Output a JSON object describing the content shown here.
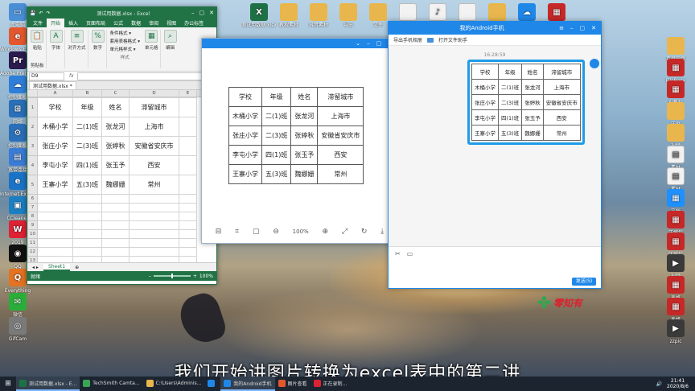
{
  "desktop": {
    "icons_left": [
      {
        "label": "此电脑",
        "color": "#4a8fd6",
        "glyph": "▭"
      },
      {
        "label": "Windows Explorer",
        "color": "#e4572e",
        "glyph": "e"
      },
      {
        "label": "Adobe Premiere Pro",
        "color": "#2b1a4d",
        "glyph": "Pr"
      },
      {
        "label": "控制面板",
        "color": "#2f7ed8",
        "glyph": "☁"
      },
      {
        "label": "网络",
        "color": "#2a6fb8",
        "glyph": "⊞"
      },
      {
        "label": "控制面板",
        "color": "#2a6fb8",
        "glyph": "⚙"
      },
      {
        "label": "宽带连接",
        "color": "#3a7bd5",
        "glyph": "▤"
      },
      {
        "label": "Internet Explorer",
        "color": "#1a73c7",
        "glyph": "e"
      },
      {
        "label": "CCleaner",
        "color": "#1c7fc4",
        "glyph": "▣"
      },
      {
        "label": "2019",
        "color": "#d23",
        "glyph": "W"
      },
      {
        "label": "QQ",
        "color": "#111",
        "glyph": "◉"
      },
      {
        "label": "Everything",
        "color": "#e37222",
        "glyph": "Q"
      },
      {
        "label": "微信",
        "color": "#2bad3a",
        "glyph": "✉"
      },
      {
        "label": "GifCam",
        "color": "#7a7a7a",
        "glyph": "◎"
      }
    ],
    "icons_top": [
      {
        "label": "测试用数据.xlsx",
        "color": "#1e7145",
        "glyph": "X"
      },
      {
        "label": "教程素材",
        "color": "#e8b64c",
        "glyph": ""
      },
      {
        "label": "抖音素材",
        "color": "#e8b64c",
        "glyph": ""
      },
      {
        "label": "导出",
        "color": "#e8b64c",
        "glyph": ""
      },
      {
        "label": "文件",
        "color": "#e8b64c",
        "glyph": ""
      },
      {
        "label": "新建",
        "color": "#f2f2f2",
        "glyph": ""
      },
      {
        "label": "WAV",
        "color": "#f2f2f2",
        "glyph": "♪"
      },
      {
        "label": "文件",
        "color": "#f2f2f2",
        "glyph": ""
      },
      {
        "label": "文件",
        "color": "#e8b64c",
        "glyph": ""
      },
      {
        "label": "上传",
        "color": "#1f87e8",
        "glyph": "☁"
      },
      {
        "label": "活动1",
        "color": "#c62828",
        "glyph": "▦"
      }
    ],
    "icons_right": [
      {
        "label": "百度网盘",
        "color": "#e8b64c",
        "glyph": ""
      },
      {
        "label": "FileRecv",
        "color": "#c62828",
        "glyph": "▦"
      },
      {
        "label": "AI教程",
        "color": "#c62828",
        "glyph": "▦"
      },
      {
        "label": "压缩",
        "color": "#e8b64c",
        "glyph": ""
      },
      {
        "label": "视频",
        "color": "#e8b64c",
        "glyph": ""
      },
      {
        "label": "素材",
        "color": "#f2f2f2",
        "glyph": "▤"
      },
      {
        "label": "素材",
        "color": "#f2f2f2",
        "glyph": "▤"
      },
      {
        "label": "文档",
        "color": "#1e90ff",
        "glyph": "▦"
      },
      {
        "label": "压缩包",
        "color": "#c62828",
        "glyph": "▦"
      },
      {
        "label": "压缩包",
        "color": "#c62828",
        "glyph": "▦"
      },
      {
        "label": "视频",
        "color": "#3a3a3a",
        "glyph": "▶"
      },
      {
        "label": "表格",
        "color": "#c62828",
        "glyph": "▦"
      },
      {
        "label": "表格",
        "color": "#c62828",
        "glyph": "▦"
      },
      {
        "label": "zzpic",
        "color": "#3a3a3a",
        "glyph": "▶"
      }
    ]
  },
  "table": {
    "headers": [
      "学校",
      "年级",
      "姓名",
      "滞留城市"
    ],
    "rows": [
      [
        "木桶小学",
        "二(1)班",
        "张龙河",
        "上海市"
      ],
      [
        "张庄小学",
        "二(3)班",
        "张婷秋",
        "安徽省安庆市"
      ],
      [
        "李屯小学",
        "四(1)班",
        "张玉予",
        "西安"
      ],
      [
        "王寨小学",
        "五(3)班",
        "魏娜姗",
        "常州"
      ]
    ]
  },
  "excel": {
    "title": "测试用数据.xlsx - Excel",
    "ribbon_tabs": [
      "文件",
      "开始",
      "插入",
      "页面布局",
      "公式",
      "数据",
      "审阅",
      "视图",
      "办公标签"
    ],
    "active_tab": "开始",
    "groups": {
      "paste": "粘贴",
      "clipboard": "剪贴板",
      "font": "字体",
      "align": "对齐方式",
      "number": "数字",
      "cells": "单元格",
      "edit": "编辑",
      "styles_label": "样式",
      "style_items": [
        "条件格式 ▾",
        "套用表格格式 ▾",
        "单元格样式 ▾"
      ]
    },
    "name_box": "D9",
    "fx": "fx",
    "file_tab": "测试用数据.xlsx *",
    "columns": [
      "A",
      "B",
      "C",
      "D",
      "E"
    ],
    "row_numbers": [
      "1",
      "2",
      "3",
      "4",
      "5",
      "6",
      "7",
      "8",
      "9",
      "10",
      "11",
      "12",
      "13",
      "14",
      "15",
      "16",
      "17",
      "18",
      "19",
      "20",
      "21",
      "22"
    ],
    "sheet": "Sheet1",
    "add_sheet": "⊕",
    "status": "就绪",
    "zoom": "100%"
  },
  "viewer": {
    "zoom": "100%",
    "tools": [
      "⊟",
      "⌗",
      "▢",
      "⊖",
      "⊕",
      "⤢",
      "↻",
      "⤓"
    ]
  },
  "phone": {
    "title": "我的Android手机",
    "tools": [
      "导出手机相册",
      "打开文件助手"
    ],
    "timestamp": "16:28:59",
    "send": "发送(S)",
    "input_icons": [
      "✂",
      "▭"
    ]
  },
  "watermark": {
    "text": "零知有"
  },
  "subtitle": "我们开始讲图片转换为excel表中的第二讲",
  "taskbar": {
    "start": "⊞",
    "items": [
      {
        "label": "测试用数据.xlsx - E...",
        "color": "#1e7145",
        "active": true
      },
      {
        "label": "TechSmith Camta...",
        "color": "#3aa655",
        "active": false
      },
      {
        "label": "C:\\Users\\Adminis...",
        "color": "#e8b64c",
        "active": false
      },
      {
        "label": "",
        "color": "#1f87e8",
        "active": false
      },
      {
        "label": "我的Android手机",
        "color": "#1f87e8",
        "active": true
      },
      {
        "label": "图片查看",
        "color": "#e4572e",
        "active": false
      },
      {
        "label": "正在录制...",
        "color": "#d23",
        "active": false
      }
    ],
    "time": "21:41",
    "date": "2020/8/6"
  },
  "colors": {
    "excel_green": "#217346",
    "blue_accent": "#1f87e8"
  }
}
